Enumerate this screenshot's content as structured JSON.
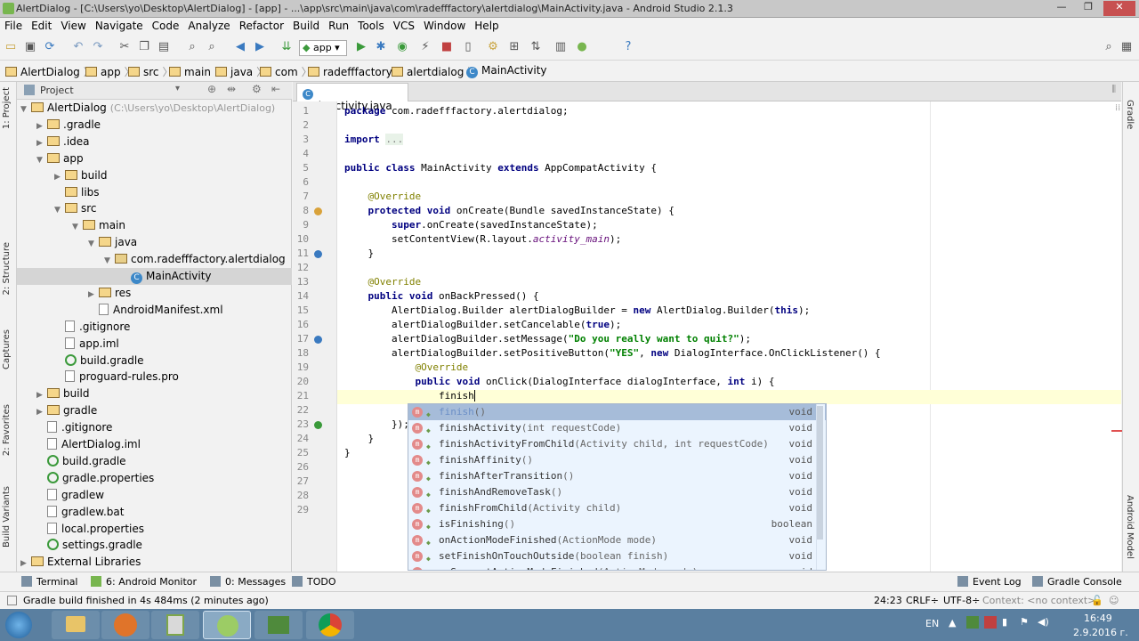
{
  "window": {
    "title": "AlertDialog - [C:\\Users\\yo\\Desktop\\AlertDialog] - [app] - ...\\app\\src\\main\\java\\com\\radefffactory\\alertdialog\\MainActivity.java - Android Studio 2.1.3",
    "controls": [
      "—",
      "❐",
      "✕"
    ]
  },
  "menu": [
    "File",
    "Edit",
    "View",
    "Navigate",
    "Code",
    "Analyze",
    "Refactor",
    "Build",
    "Run",
    "Tools",
    "VCS",
    "Window",
    "Help"
  ],
  "toolbar": {
    "run_config": "app"
  },
  "breadcrumbs": [
    "AlertDialog",
    "app",
    "src",
    "main",
    "java",
    "com",
    "radefffactory",
    "alertdialog",
    "MainActivity"
  ],
  "left_tool_tabs": [
    "1: Project",
    "2: Structure",
    "Captures",
    "2: Favorites",
    "Build Variants"
  ],
  "right_tool_tabs": [
    "Gradle",
    "Android Model"
  ],
  "project": {
    "header": "Project",
    "tree": [
      {
        "label": "AlertDialog",
        "hint": "(C:\\Users\\yo\\Desktop\\AlertDialog)",
        "kind": "folder",
        "arrow": "▼"
      },
      {
        "label": ".gradle",
        "kind": "folder",
        "arrow": "▶"
      },
      {
        "label": ".idea",
        "kind": "folder",
        "arrow": "▶"
      },
      {
        "label": "app",
        "kind": "folder",
        "arrow": "▼"
      },
      {
        "label": "build",
        "kind": "folder",
        "arrow": "▶"
      },
      {
        "label": "libs",
        "kind": "folder",
        "arrow": ""
      },
      {
        "label": "src",
        "kind": "folder",
        "arrow": "▼"
      },
      {
        "label": "main",
        "kind": "folder",
        "arrow": "▼"
      },
      {
        "label": "java",
        "kind": "folder",
        "arrow": "▼"
      },
      {
        "label": "com.radefffactory.alertdialog",
        "kind": "pkg",
        "arrow": "▼"
      },
      {
        "label": "MainActivity",
        "kind": "class",
        "arrow": ""
      },
      {
        "label": "res",
        "kind": "folder",
        "arrow": "▶"
      },
      {
        "label": "AndroidManifest.xml",
        "kind": "file",
        "arrow": ""
      },
      {
        "label": ".gitignore",
        "kind": "file",
        "arrow": ""
      },
      {
        "label": "app.iml",
        "kind": "file",
        "arrow": ""
      },
      {
        "label": "build.gradle",
        "kind": "gradle",
        "arrow": ""
      },
      {
        "label": "proguard-rules.pro",
        "kind": "file",
        "arrow": ""
      },
      {
        "label": "build",
        "kind": "folder",
        "arrow": "▶"
      },
      {
        "label": "gradle",
        "kind": "folder",
        "arrow": "▶"
      },
      {
        "label": ".gitignore",
        "kind": "file",
        "arrow": ""
      },
      {
        "label": "AlertDialog.iml",
        "kind": "file",
        "arrow": ""
      },
      {
        "label": "build.gradle",
        "kind": "gradle",
        "arrow": ""
      },
      {
        "label": "gradle.properties",
        "kind": "gradle",
        "arrow": ""
      },
      {
        "label": "gradlew",
        "kind": "file",
        "arrow": ""
      },
      {
        "label": "gradlew.bat",
        "kind": "file",
        "arrow": ""
      },
      {
        "label": "local.properties",
        "kind": "file",
        "arrow": ""
      },
      {
        "label": "settings.gradle",
        "kind": "gradle",
        "arrow": ""
      },
      {
        "label": "External Libraries",
        "kind": "folder",
        "arrow": "▶"
      }
    ]
  },
  "editor": {
    "tab": "MainActivity.java",
    "line_numbers": [
      "1",
      "2",
      "3",
      "4",
      "5",
      "6",
      "7",
      "8",
      "9",
      "10",
      "11",
      "12",
      "13",
      "14",
      "15",
      "16",
      "17",
      "18",
      "19",
      "20",
      "21",
      "22",
      "23",
      "24",
      "25",
      "26",
      "27",
      "28",
      "29"
    ]
  },
  "completion": {
    "items": [
      {
        "name": "finish",
        "args": "()",
        "type": "void"
      },
      {
        "name": "finishActivity",
        "args": "(int requestCode)",
        "type": "void"
      },
      {
        "name": "finishActivityFromChild",
        "args": "(Activity child, int requestCode)",
        "type": "void"
      },
      {
        "name": "finishAffinity",
        "args": "()",
        "type": "void"
      },
      {
        "name": "finishAfterTransition",
        "args": "()",
        "type": "void"
      },
      {
        "name": "finishAndRemoveTask",
        "args": "()",
        "type": "void"
      },
      {
        "name": "finishFromChild",
        "args": "(Activity child)",
        "type": "void"
      },
      {
        "name": "isFinishing",
        "args": "()",
        "type": "boolean"
      },
      {
        "name": "onActionModeFinished",
        "args": "(ActionMode mode)",
        "type": "void"
      },
      {
        "name": "setFinishOnTouchOutside",
        "args": "(boolean finish)",
        "type": "void"
      },
      {
        "name": "onSupportActionModeFinished",
        "args": "(ActionMode mode)",
        "type": "void"
      }
    ]
  },
  "bottom_tools": {
    "terminal": "Terminal",
    "monitor": "6: Android Monitor",
    "messages": "0: Messages",
    "todo": "TODO",
    "event_log": "Event Log",
    "gradle_console": "Gradle Console"
  },
  "status": {
    "message": "Gradle build finished in 4s 484ms (2 minutes ago)",
    "position": "24:23",
    "line_sep": "CRLF÷",
    "encoding": "UTF-8÷",
    "context": "Context: <no context>"
  },
  "taskbar": {
    "lang": "EN",
    "time": "16:49",
    "date": "2.9.2016 г."
  }
}
